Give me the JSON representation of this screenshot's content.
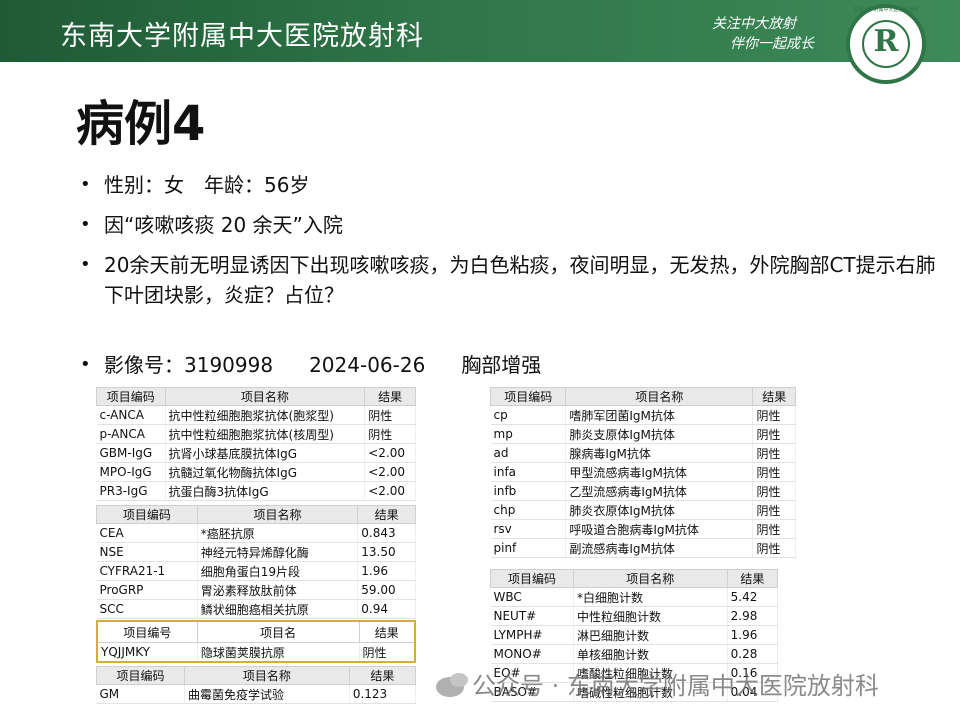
{
  "header": {
    "title": "东南大学附属中大医院放射科",
    "slogan_line1": "关注中大放射",
    "slogan_line2": "伴你一起成长",
    "logo_glyph": "R",
    "logo_ring_text": "东南大学附属中大医院放射科"
  },
  "page_title": "病例4",
  "bullets": [
    "性别：女　年龄：56岁",
    "因“咳嗽咳痰 20 余天”入院",
    "20余天前无明显诱因下出现咳嗽咳痰，为白色粘痰，夜间明显，无发热，外院胸部CT提示右肺下叶团块影，炎症？占位？"
  ],
  "imaging": {
    "label": "影像号：3190998",
    "date": "2024-06-26",
    "exam": "胸部增强"
  },
  "table_anca": {
    "headers": [
      "项目编码",
      "项目名称",
      "结果"
    ],
    "rows": [
      [
        "c-ANCA",
        "抗中性粒细胞胞浆抗体(胞浆型)",
        "阴性"
      ],
      [
        "p-ANCA",
        "抗中性粒细胞胞浆抗体(核周型)",
        "阴性"
      ],
      [
        "GBM-IgG",
        "抗肾小球基底膜抗体IgG",
        "<2.00"
      ],
      [
        "MPO-IgG",
        "抗髓过氧化物酶抗体IgG",
        "<2.00"
      ],
      [
        "PR3-IgG",
        "抗蛋白酶3抗体IgG",
        "<2.00"
      ]
    ]
  },
  "table_tumor": {
    "headers": [
      "项目编码",
      "项目名称",
      "结果"
    ],
    "rows": [
      [
        "CEA",
        "*癌胚抗原",
        "0.843"
      ],
      [
        "NSE",
        "神经元特异烯醇化酶",
        "13.50"
      ],
      [
        "CYFRA21-1",
        "细胞角蛋白19片段",
        "1.96"
      ],
      [
        "ProGRP",
        "胃泌素释放肽前体",
        "59.00"
      ],
      [
        "SCC",
        "鳞状细胞癌相关抗原",
        "0.94"
      ]
    ]
  },
  "table_crypto": {
    "headers": [
      "项目编号",
      "项目名",
      "结果"
    ],
    "rows": [
      [
        "YQJJMKY",
        "隐球菌荚膜抗原",
        "阴性"
      ]
    ]
  },
  "table_gm": {
    "headers": [
      "项目编码",
      "项目名称",
      "结果"
    ],
    "rows": [
      [
        "GM",
        "曲霉菌免疫学试验",
        "0.123"
      ]
    ]
  },
  "table_igm": {
    "headers": [
      "项目编码",
      "项目名称",
      "结果"
    ],
    "rows": [
      [
        "cp",
        "嗜肺军团菌IgM抗体",
        "阴性"
      ],
      [
        "mp",
        "肺炎支原体IgM抗体",
        "阴性"
      ],
      [
        "ad",
        "腺病毒IgM抗体",
        "阴性"
      ],
      [
        "infa",
        "甲型流感病毒IgM抗体",
        "阴性"
      ],
      [
        "infb",
        "乙型流感病毒IgM抗体",
        "阴性"
      ],
      [
        "chp",
        "肺炎衣原体IgM抗体",
        "阴性"
      ],
      [
        "rsv",
        "呼吸道合胞病毒IgM抗体",
        "阴性"
      ],
      [
        "pinf",
        "副流感病毒IgM抗体",
        "阴性"
      ]
    ]
  },
  "table_blood": {
    "headers": [
      "项目编码",
      "项目名称",
      "结果"
    ],
    "rows": [
      [
        "WBC",
        "*白细胞计数",
        "5.42"
      ],
      [
        "NEUT#",
        "中性粒细胞计数",
        "2.98"
      ],
      [
        "LYMPH#",
        "淋巴细胞计数",
        "1.96"
      ],
      [
        "MONO#",
        "单核细胞计数",
        "0.28"
      ],
      [
        "EO#",
        "嗜酸性粒细胞计数",
        "0.16"
      ],
      [
        "BASO#",
        "嗜碱性粒细胞计数",
        "0.04"
      ]
    ]
  },
  "watermark": "公众号 · 东南大学附属中大医院放射科"
}
